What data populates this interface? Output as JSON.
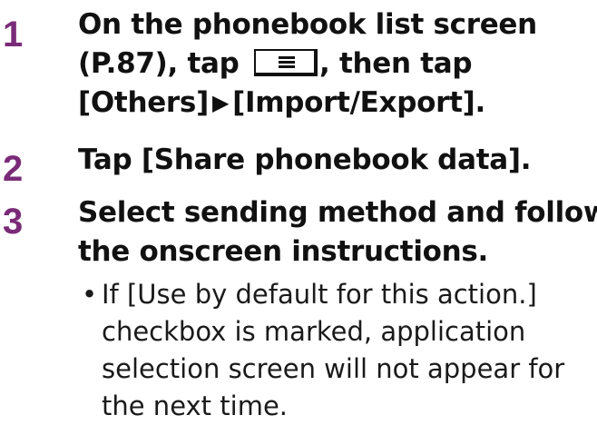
{
  "steps": [
    {
      "number": "1",
      "line1": "On the phonebook list screen",
      "line2_before_icon": "(P.87), tap",
      "line2_after_icon": ", then tap",
      "line3_part1": "[Others]",
      "line3_arrow": "▶",
      "line3_part2": "[Import/Export]."
    },
    {
      "number": "2",
      "text": "Tap [Share phonebook data]."
    },
    {
      "number": "3",
      "line1": "Select sending method and follow",
      "line2": "the onscreen instructions."
    }
  ],
  "note": {
    "bullet": "•",
    "text": "If [Use by default for this action.] checkbox is marked, application selection screen will not appear for the next time."
  },
  "icons": {
    "menu_key": "menu-key-icon"
  },
  "colors": {
    "step_number": "#7a2b78",
    "text": "#111111"
  }
}
